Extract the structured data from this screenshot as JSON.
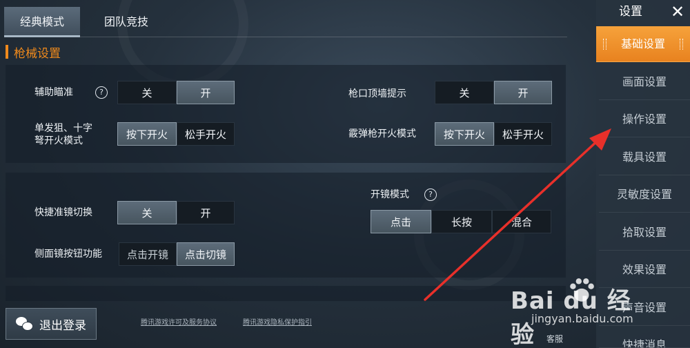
{
  "tabs": [
    {
      "label": "经典模式",
      "active": true
    },
    {
      "label": "团队竞技",
      "active": false
    }
  ],
  "section_title": "枪械设置",
  "settings": {
    "aim_assist": {
      "label": "辅助瞄准",
      "options": [
        "关",
        "开"
      ],
      "selected": "开"
    },
    "muzzle_wall_hint": {
      "label": "枪口顶墙提示",
      "options": [
        "关",
        "开"
      ],
      "selected": "开"
    },
    "sniper_fire": {
      "label_line1": "单发狙、十字",
      "label_line2": "弩开火模式",
      "options": [
        "按下开火",
        "松手开火"
      ],
      "selected": "按下开火"
    },
    "shotgun_fire": {
      "label": "霰弹枪开火模式",
      "options": [
        "按下开火",
        "松手开火"
      ],
      "selected": "按下开火"
    },
    "quick_scope_switch": {
      "label": "快捷准镜切换",
      "options": [
        "关",
        "开"
      ],
      "selected": "关"
    },
    "scope_mode": {
      "label": "开镜模式",
      "options": [
        "点击",
        "长按",
        "混合"
      ],
      "selected": "点击"
    },
    "side_scope_button": {
      "label": "侧面镜按钮功能",
      "options": [
        "点击开镜",
        "点击切镜"
      ],
      "selected": "点击切镜"
    }
  },
  "help_glyph": "?",
  "sidebar": {
    "title": "设置",
    "close_glyph": "✕",
    "items": [
      {
        "label": "基础设置",
        "active": true
      },
      {
        "label": "画面设置",
        "active": false
      },
      {
        "label": "操作设置",
        "active": false
      },
      {
        "label": "载具设置",
        "active": false
      },
      {
        "label": "灵敏度设置",
        "active": false
      },
      {
        "label": "拾取设置",
        "active": false
      },
      {
        "label": "效果设置",
        "active": false
      },
      {
        "label": "声音设置",
        "active": false
      },
      {
        "label": "快捷消息",
        "active": false
      }
    ]
  },
  "footer": {
    "logout_label": "退出登录",
    "link_license": "腾讯游戏许可及服务协议",
    "link_privacy": "腾讯游戏隐私保护指引",
    "support_label": "客服"
  },
  "watermark": {
    "logo_text": "Bai  du 经验",
    "url": "jingyan.baidu.com"
  },
  "colors": {
    "accent": "#f08a1c",
    "annotation_arrow": "#e8302a"
  }
}
